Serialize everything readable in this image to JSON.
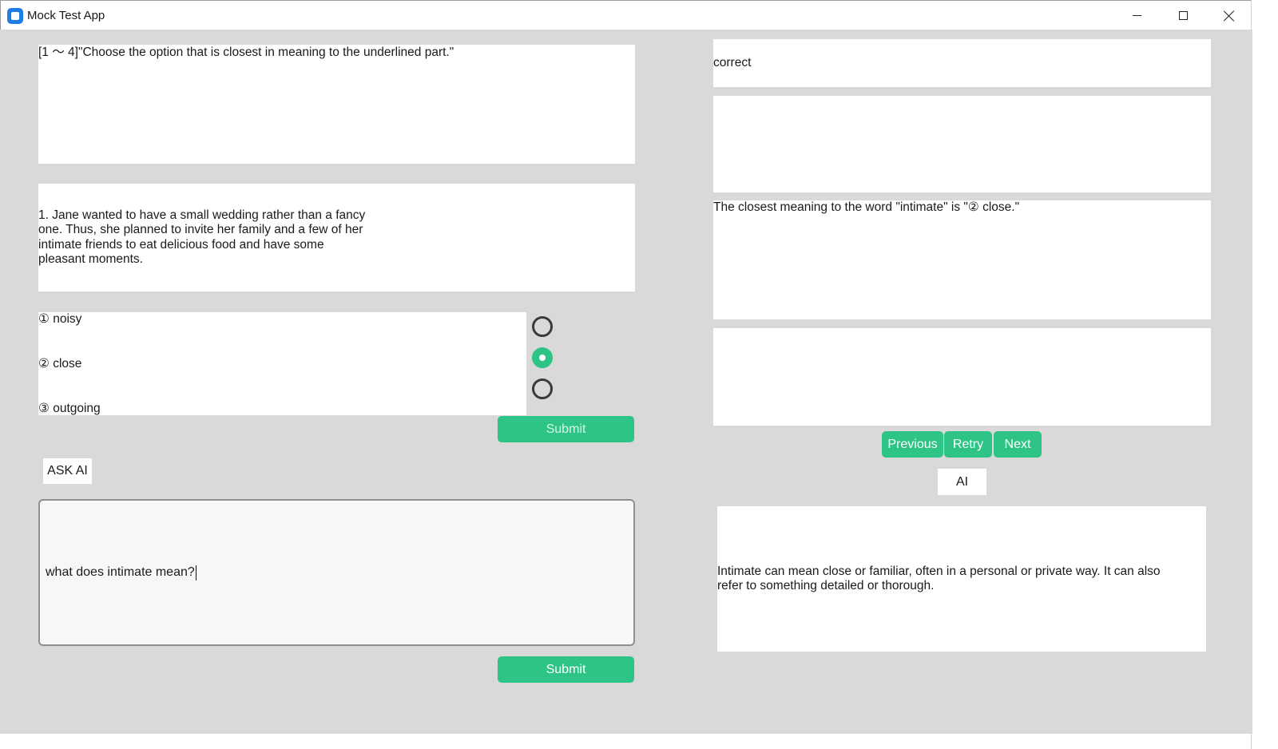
{
  "window": {
    "title": "Mock Test App"
  },
  "question": {
    "instruction": "[1 ～ 4]\"Choose the option that is closest in meaning to the underlined part.\"",
    "passage": "1. Jane wanted to have a small wedding rather than a fancy one. Thus, she planned to invite her family and a few of her intimate friends to eat delicious food and have some pleasant moments.",
    "options": [
      "① noisy",
      "② close",
      "③ outgoing"
    ],
    "selected_option_index": 1,
    "submit_label": "Submit"
  },
  "ask_ai": {
    "label": "ASK AI",
    "input_value": "what does intimate mean?",
    "submit_label": "Submit"
  },
  "results": {
    "status": "correct",
    "explanation": "The closest meaning to the word \"intimate\" is \"② close.\""
  },
  "navigation": {
    "previous_label": "Previous",
    "retry_label": "Retry",
    "next_label": "Next"
  },
  "ai_panel": {
    "label": "AI",
    "answer": "Intimate can mean close or familiar, often in a personal or private way. It can also refer to something detailed or thorough."
  },
  "colors": {
    "accent": "#2ec486",
    "background": "#d9d9d9"
  }
}
